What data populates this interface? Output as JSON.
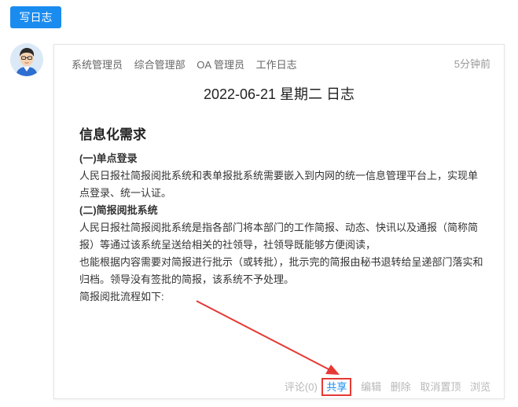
{
  "toolbar": {
    "write_label": "写日志"
  },
  "log": {
    "tags": [
      "系统管理员",
      "综合管理部",
      "OA 管理员",
      "工作日志"
    ],
    "time": "5分钟前",
    "title": "2022-06-21 星期二 日志",
    "heading": "信息化需求",
    "section1_title": "(一)单点登录",
    "section1_text": "人民日报社简报阅批系统和表单报批系统需要嵌入到内网的统一信息管理平台上，实现单点登录、统一认证。",
    "section2_title": "(二)简报阅批系统",
    "section2_text1": "人民日报社简报阅批系统是指各部门将本部门的工作简报、动态、快讯以及通报（简称简报）等通过该系统呈送给相关的社领导，社领导既能够方便阅读，",
    "section2_text2": "也能根据内容需要对简报进行批示（或转批），批示完的简报由秘书退转给呈递部门落实和归档。领导没有签批的简报，该系统不予处理。",
    "flow_text": "简报阅批流程如下:"
  },
  "actions": {
    "comment": "评论(0)",
    "share": "共享",
    "edit": "编辑",
    "delete": "删除",
    "unpin": "取消置顶",
    "browse": "浏览"
  },
  "colors": {
    "accent": "#1a8cf0",
    "highlight": "#e53935"
  }
}
